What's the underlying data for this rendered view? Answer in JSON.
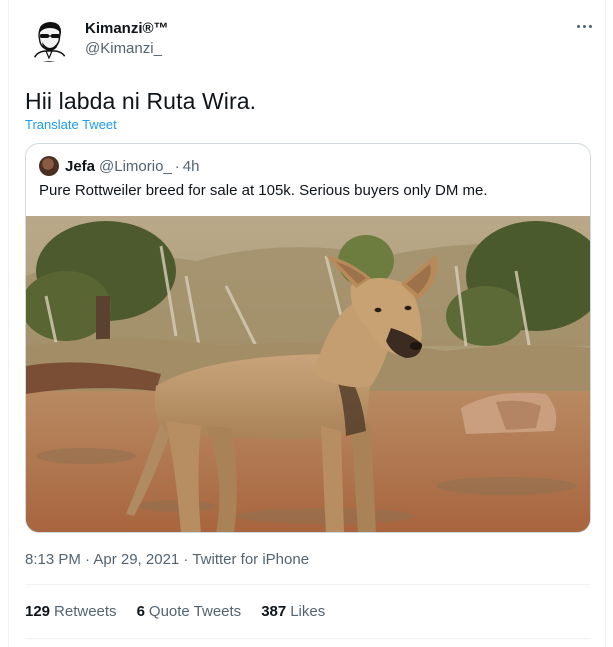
{
  "author": {
    "name": "Kimanzi®™",
    "handle": "@Kimanzi_"
  },
  "tweet": {
    "text": "Hii labda ni Ruta Wira.",
    "translate_label": "Translate Tweet"
  },
  "quoted_tweet": {
    "name": "Jefa",
    "handle": "@Limorio_",
    "separator": "·",
    "time": "4h",
    "text": "Pure Rottweiler breed for sale at 105k. Serious buyers only DM me."
  },
  "meta": {
    "timestamp": "8:13 PM · Apr 29, 2021 · Twitter for iPhone"
  },
  "stats": {
    "retweets_count": "129",
    "retweets_label": "Retweets",
    "quotes_count": "6",
    "quotes_label": "Quote Tweets",
    "likes_count": "387",
    "likes_label": "Likes"
  },
  "icons": {
    "more": "more-horizontal-icon"
  },
  "colors": {
    "link": "#1d9bf0",
    "secondary_text": "#536471",
    "primary_text": "#0f1419",
    "border": "#cfd9de"
  }
}
